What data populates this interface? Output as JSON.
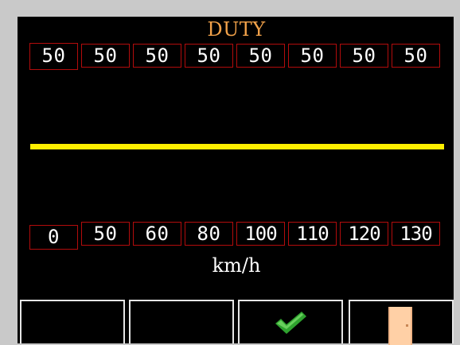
{
  "screen": {
    "title": "DUTY",
    "unit_label": "km/h"
  },
  "duty_values": [
    "50",
    "50",
    "50",
    "50",
    "50",
    "50",
    "50",
    "50"
  ],
  "speed_values": [
    "0",
    "50",
    "60",
    "80",
    "100",
    "110",
    "120",
    "130"
  ],
  "buttons": {
    "btn1": {
      "icon": ""
    },
    "btn2": {
      "icon": ""
    },
    "btn3": {
      "icon": "check-icon"
    },
    "btn4": {
      "icon": "door-icon"
    }
  },
  "colors": {
    "title": "#f2a24a",
    "cell_border": "#b30c0c",
    "duty_line": "#ffef00",
    "check": "#2fa32f",
    "door": "#ffd0a6"
  }
}
